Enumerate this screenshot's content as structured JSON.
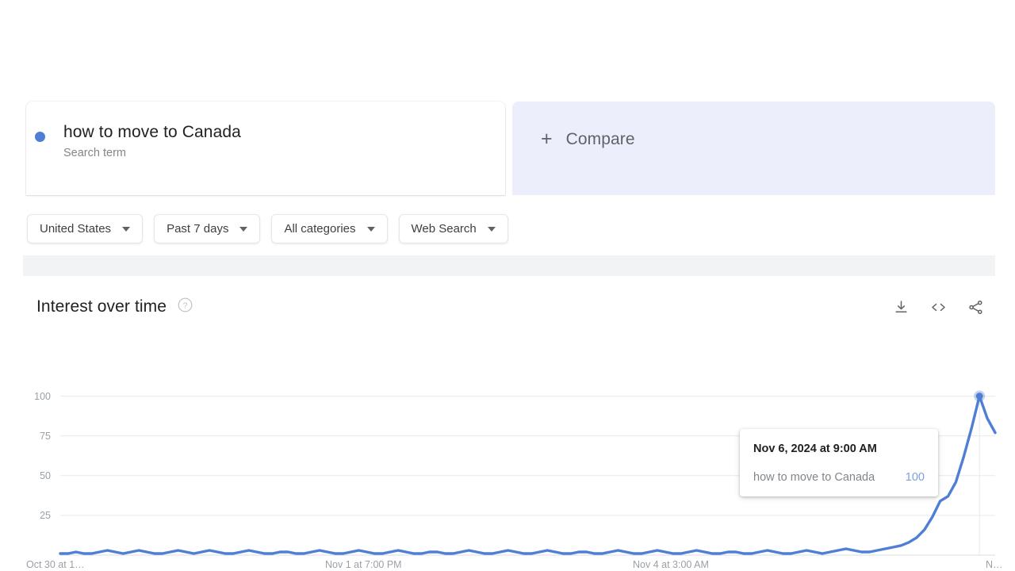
{
  "term_bar": {
    "term": {
      "title": "how to move to Canada",
      "subtitle": "Search term",
      "dot_color": "#4f7fd4"
    },
    "compare": {
      "plus": "+",
      "label": "Compare"
    }
  },
  "filters": [
    {
      "label": "United States",
      "icon": "chevron-down-icon"
    },
    {
      "label": "Past 7 days",
      "icon": "chevron-down-icon"
    },
    {
      "label": "All categories",
      "icon": "chevron-down-icon"
    },
    {
      "label": "Web Search",
      "icon": "chevron-down-icon"
    }
  ],
  "chart_header": {
    "title": "Interest over time",
    "help_icon": "help-circle-icon",
    "actions": [
      {
        "name": "download-icon"
      },
      {
        "name": "embed-code-icon"
      },
      {
        "name": "share-icon"
      }
    ]
  },
  "tooltip": {
    "date": "Nov 6, 2024 at 9:00 AM",
    "term": "how to move to Canada",
    "value": "100",
    "value_color": "#7c9ee0"
  },
  "chart_data": {
    "type": "line",
    "title": "Interest over time",
    "xlabel": "",
    "ylabel": "",
    "ylim": [
      0,
      100
    ],
    "grid": true,
    "legend_position": "top",
    "line_color": "#4f7fd4",
    "series": [
      {
        "name": "how to move to Canada",
        "values": [
          1,
          1,
          2,
          1,
          1,
          2,
          3,
          2,
          1,
          2,
          3,
          2,
          1,
          1,
          2,
          3,
          2,
          1,
          2,
          3,
          2,
          1,
          1,
          2,
          3,
          2,
          1,
          1,
          2,
          2,
          1,
          1,
          2,
          3,
          2,
          1,
          1,
          2,
          3,
          2,
          1,
          1,
          2,
          3,
          2,
          1,
          1,
          2,
          2,
          1,
          1,
          2,
          3,
          2,
          1,
          1,
          2,
          3,
          2,
          1,
          1,
          2,
          3,
          2,
          1,
          1,
          2,
          2,
          1,
          1,
          2,
          3,
          2,
          1,
          1,
          2,
          3,
          2,
          1,
          1,
          2,
          3,
          2,
          1,
          1,
          2,
          2,
          1,
          1,
          2,
          3,
          2,
          1,
          1,
          2,
          3,
          2,
          1,
          2,
          3,
          4,
          3,
          2,
          2,
          3,
          4,
          5,
          6,
          8,
          11,
          16,
          24,
          34,
          37,
          46,
          62,
          80,
          100,
          86,
          77
        ]
      }
    ],
    "y_ticks": [
      {
        "value": 100,
        "label": "100"
      },
      {
        "value": 75,
        "label": "75"
      },
      {
        "value": 50,
        "label": "50"
      },
      {
        "value": 25,
        "label": "25"
      }
    ],
    "x_ticks": [
      {
        "label": "Oct 30 at 1…"
      },
      {
        "label": "Nov 1 at 7:00 PM"
      },
      {
        "label": "Nov 4 at 3:00 AM"
      },
      {
        "label": "N…"
      }
    ],
    "highlight_point": {
      "label": "Nov 6, 2024 at 9:00 AM",
      "value": 100
    }
  }
}
